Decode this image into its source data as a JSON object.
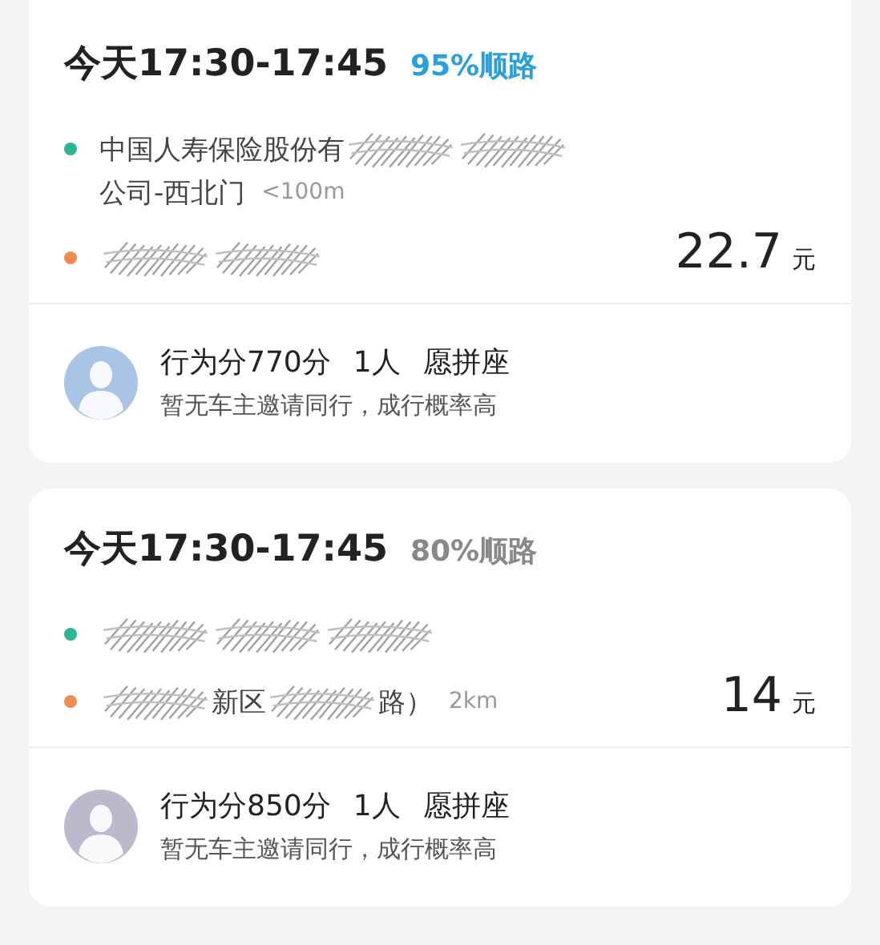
{
  "cards": [
    {
      "time": "今天17:30-17:45",
      "match": "95%顺路",
      "match_highlight": true,
      "start": {
        "lines": [
          [
            {
              "kind": "text",
              "text": "中国人寿保险股份有"
            },
            {
              "kind": "redacted"
            },
            {
              "kind": "redacted"
            }
          ],
          [
            {
              "kind": "text",
              "text": "公司-西北门"
            }
          ]
        ],
        "distance": "<100m"
      },
      "end": {
        "lines": [
          [
            {
              "kind": "redacted"
            },
            {
              "kind": "redacted"
            }
          ]
        ]
      },
      "price": "22.7",
      "unit": "元",
      "avatar": {
        "color": "#a9c4e4"
      },
      "score": "行为分770分",
      "people": "1人",
      "seat": "愿拼座",
      "note": "暂无车主邀请同行，成行概率高"
    },
    {
      "time": "今天17:30-17:45",
      "match": "80%顺路",
      "match_highlight": false,
      "start": {
        "lines": [
          [
            {
              "kind": "redacted"
            },
            {
              "kind": "redacted"
            },
            {
              "kind": "redacted"
            }
          ]
        ]
      },
      "end": {
        "lines": [
          [
            {
              "kind": "redacted"
            },
            {
              "kind": "text",
              "text": "新区"
            },
            {
              "kind": "redacted"
            },
            {
              "kind": "text",
              "text": "路）"
            }
          ]
        ],
        "distance": "2km"
      },
      "price": "14",
      "unit": "元",
      "avatar": {
        "color": "#bdb8cc"
      },
      "score": "行为分850分",
      "people": "1人",
      "seat": "愿拼座",
      "note": "暂无车主邀请同行，成行概率高"
    }
  ]
}
